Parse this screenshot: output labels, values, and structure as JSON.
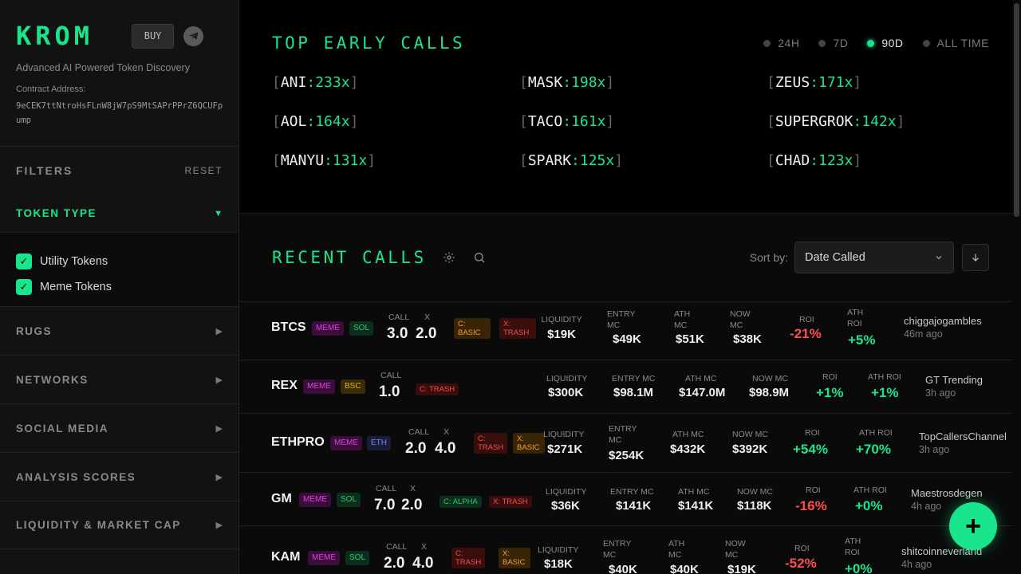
{
  "brand": {
    "logo": "KROM",
    "buy_label": "BUY",
    "tagline": "Advanced AI Powered Token Discovery",
    "contract_label": "Contract Address:",
    "contract_value": "9eCEK7ttNtroHsFLnW8jW7pS9MtSAPrPPrZ6QCUFpump",
    "accent": "#19e68c"
  },
  "filters": {
    "title": "FILTERS",
    "reset": "RESET",
    "token_type": {
      "label": "TOKEN TYPE",
      "options": [
        {
          "label": "Utility Tokens",
          "checked": true
        },
        {
          "label": "Meme Tokens",
          "checked": true
        }
      ]
    },
    "sections": [
      "RUGS",
      "NETWORKS",
      "SOCIAL MEDIA",
      "ANALYSIS SCORES",
      "LIQUIDITY & MARKET CAP"
    ]
  },
  "top_calls": {
    "title": "TOP EARLY CALLS",
    "ranges": [
      {
        "label": "24H",
        "active": false
      },
      {
        "label": "7D",
        "active": false
      },
      {
        "label": "90D",
        "active": true
      },
      {
        "label": "ALL TIME",
        "active": false
      }
    ],
    "items": [
      {
        "token": "ANI",
        "mult": "233x"
      },
      {
        "token": "MASK",
        "mult": "198x"
      },
      {
        "token": "ZEUS",
        "mult": "171x"
      },
      {
        "token": "AOL",
        "mult": "164x"
      },
      {
        "token": "TACO",
        "mult": "161x"
      },
      {
        "token": "SUPERGROK",
        "mult": "142x"
      },
      {
        "token": "MANYU",
        "mult": "131x"
      },
      {
        "token": "SPARK",
        "mult": "125x"
      },
      {
        "token": "CHAD",
        "mult": "123x"
      }
    ]
  },
  "recent": {
    "title": "RECENT CALLS",
    "sort_label": "Sort by:",
    "sort_value": "Date Called",
    "rows": [
      {
        "symbol": "BTCS",
        "tags": [
          "MEME",
          "SOL"
        ],
        "call_label": "CALL",
        "call": "3.0",
        "x_label": "X",
        "x": "2.0",
        "badges": [
          "C: BASIC",
          "X: TRASH"
        ],
        "liq_label": "LIQUIDITY",
        "liquidity": "$19K",
        "entry_label": "ENTRY MC",
        "entry": "$49K",
        "ath_label": "ATH MC",
        "ath": "$51K",
        "now_label": "NOW MC",
        "now": "$38K",
        "roi_label": "ROI",
        "roi": "-21%",
        "athroi_label": "ATH ROI",
        "athroi": "+5%",
        "caller": "chiggajogambles",
        "ago": "46m ago"
      },
      {
        "symbol": "REX",
        "tags": [
          "MEME",
          "BSC"
        ],
        "call_label": "CALL",
        "call": "1.0",
        "badges": [
          "C: TRASH"
        ],
        "liq_label": "LIQUIDITY",
        "liquidity": "$300K",
        "entry_label": "ENTRY MC",
        "entry": "$98.1M",
        "ath_label": "ATH MC",
        "ath": "$147.0M",
        "now_label": "NOW MC",
        "now": "$98.9M",
        "roi_label": "ROI",
        "roi": "+1%",
        "athroi_label": "ATH ROI",
        "athroi": "+1%",
        "caller": "GT Trending",
        "ago": "3h ago"
      },
      {
        "symbol": "ETHPRO",
        "tags": [
          "MEME",
          "ETH"
        ],
        "call_label": "CALL",
        "call": "2.0",
        "x_label": "X",
        "x": "4.0",
        "badges": [
          "C: TRASH",
          "X: BASIC"
        ],
        "liq_label": "LIQUIDITY",
        "liquidity": "$271K",
        "entry_label": "ENTRY MC",
        "entry": "$254K",
        "ath_label": "ATH MC",
        "ath": "$432K",
        "now_label": "NOW MC",
        "now": "$392K",
        "roi_label": "ROI",
        "roi": "+54%",
        "athroi_label": "ATH ROI",
        "athroi": "+70%",
        "caller": "TopCallersChannel",
        "ago": "3h ago"
      },
      {
        "symbol": "GM",
        "tags": [
          "MEME",
          "SOL"
        ],
        "call_label": "CALL",
        "call": "7.0",
        "x_label": "X",
        "x": "2.0",
        "badges": [
          "C: ALPHA",
          "X: TRASH"
        ],
        "liq_label": "LIQUIDITY",
        "liquidity": "$36K",
        "entry_label": "ENTRY MC",
        "entry": "$141K",
        "ath_label": "ATH MC",
        "ath": "$141K",
        "now_label": "NOW MC",
        "now": "$118K",
        "roi_label": "ROI",
        "roi": "-16%",
        "athroi_label": "ATH ROI",
        "athroi": "+0%",
        "caller": "Maestrosdegen",
        "ago": "4h ago"
      },
      {
        "symbol": "KAM",
        "tags": [
          "MEME",
          "SOL"
        ],
        "call_label": "CALL",
        "call": "2.0",
        "x_label": "X",
        "x": "4.0",
        "badges": [
          "C: TRASH",
          "X: BASIC"
        ],
        "liq_label": "LIQUIDITY",
        "liquidity": "$18K",
        "entry_label": "ENTRY MC",
        "entry": "$40K",
        "ath_label": "ATH MC",
        "ath": "$40K",
        "now_label": "NOW MC",
        "now": "$19K",
        "roi_label": "ROI",
        "roi": "-52%",
        "athroi_label": "ATH ROI",
        "athroi": "+0%",
        "caller": "shitcoinneverland",
        "ago": "4h ago"
      }
    ]
  },
  "fab_label": "+"
}
